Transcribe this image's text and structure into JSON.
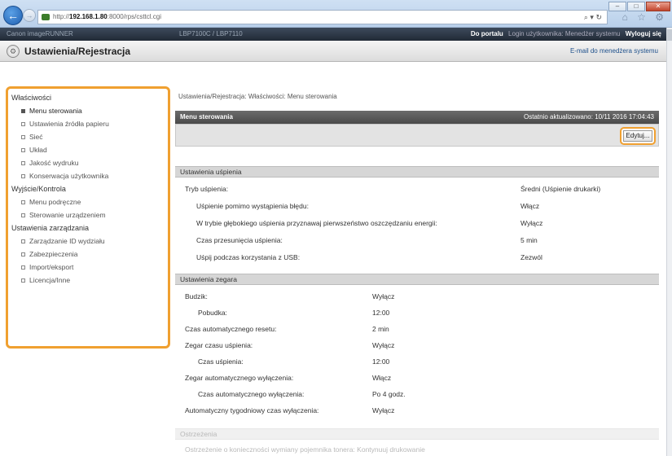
{
  "browser": {
    "url_prefix": "http://",
    "url_host": "192.168.1.80",
    "url_rest": ":8000/rps/csttcl.cgi",
    "addr_controls": "⌕ ▾ ↻",
    "win_min": "–",
    "win_max": "□",
    "win_close": "✕",
    "nav_icons": "⌂ ☆ ⚙"
  },
  "portal": {
    "left_text": "Canon imageRUNNER",
    "mid_text": "LBP7100C / LBP7110",
    "link_portal": "Do portalu",
    "login_user": "Login użytkownika: Menedżer systemu",
    "logout": "Wyloguj się"
  },
  "header": {
    "title": "Ustawienia/Rejestracja",
    "email_link": "E-mail do menedżera systemu"
  },
  "sidebar": {
    "groups": [
      {
        "label": "Właściwości",
        "items": [
          "Menu sterowania",
          "Ustawienia źródła papieru",
          "Sieć",
          "Układ",
          "Jakość wydruku",
          "Konserwacja użytkownika"
        ]
      },
      {
        "label": "Wyjście/Kontrola",
        "items": [
          "Menu podręczne",
          "Sterowanie urządzeniem"
        ]
      },
      {
        "label": "Ustawienia zarządzania",
        "items": [
          "Zarządzanie ID wydziału",
          "Zabezpieczenia",
          "Import/eksport",
          "Licencja/Inne"
        ]
      }
    ]
  },
  "main": {
    "breadcrumb": "Ustawienia/Rejestracja: Właściwości: Menu sterowania",
    "panel_title": "Menu sterowania",
    "last_updated": "Ostatnio aktualizowano: 10/11 2016 17:04:43",
    "edit_label": "Edytuj...",
    "sleep": {
      "title": "Ustawienia uśpienia",
      "rows": [
        {
          "label": "Tryb uśpienia:",
          "value": "Średni (Uśpienie drukarki)"
        },
        {
          "label": "Uśpienie pomimo wystąpienia błędu:",
          "value": "Włącz"
        },
        {
          "label": "W trybie głębokiego uśpienia przyznawaj pierwszeństwo oszczędzaniu energii:",
          "value": "Wyłącz"
        },
        {
          "label": "Czas przesunięcia uśpienia:",
          "value": "5 min"
        },
        {
          "label": "Uśpij podczas korzystania z USB:",
          "value": "Zezwól"
        }
      ]
    },
    "timer": {
      "title": "Ustawienia zegara",
      "rows": [
        {
          "label": "Budzik:",
          "value": "Wyłącz"
        },
        {
          "label": "Pobudka:",
          "value": "12:00"
        },
        {
          "label": "Czas automatycznego resetu:",
          "value": "2 min"
        },
        {
          "label": "Zegar czasu uśpienia:",
          "value": "Wyłącz"
        },
        {
          "label": "Czas uśpienia:",
          "value": "12:00"
        },
        {
          "label": "Zegar automatycznego wyłączenia:",
          "value": "Włącz"
        },
        {
          "label": "Czas automatycznego wyłączenia:",
          "value": "Po 4 godz."
        },
        {
          "label": "Automatyczny tygodniowy czas wyłączenia:",
          "value": "Wyłącz"
        }
      ]
    },
    "footer_section": "Ostrzeżenia",
    "footer_row": "Ostrzeżenie o konieczności wymiany pojemnika tonera:   Kontynuuj drukowanie"
  }
}
